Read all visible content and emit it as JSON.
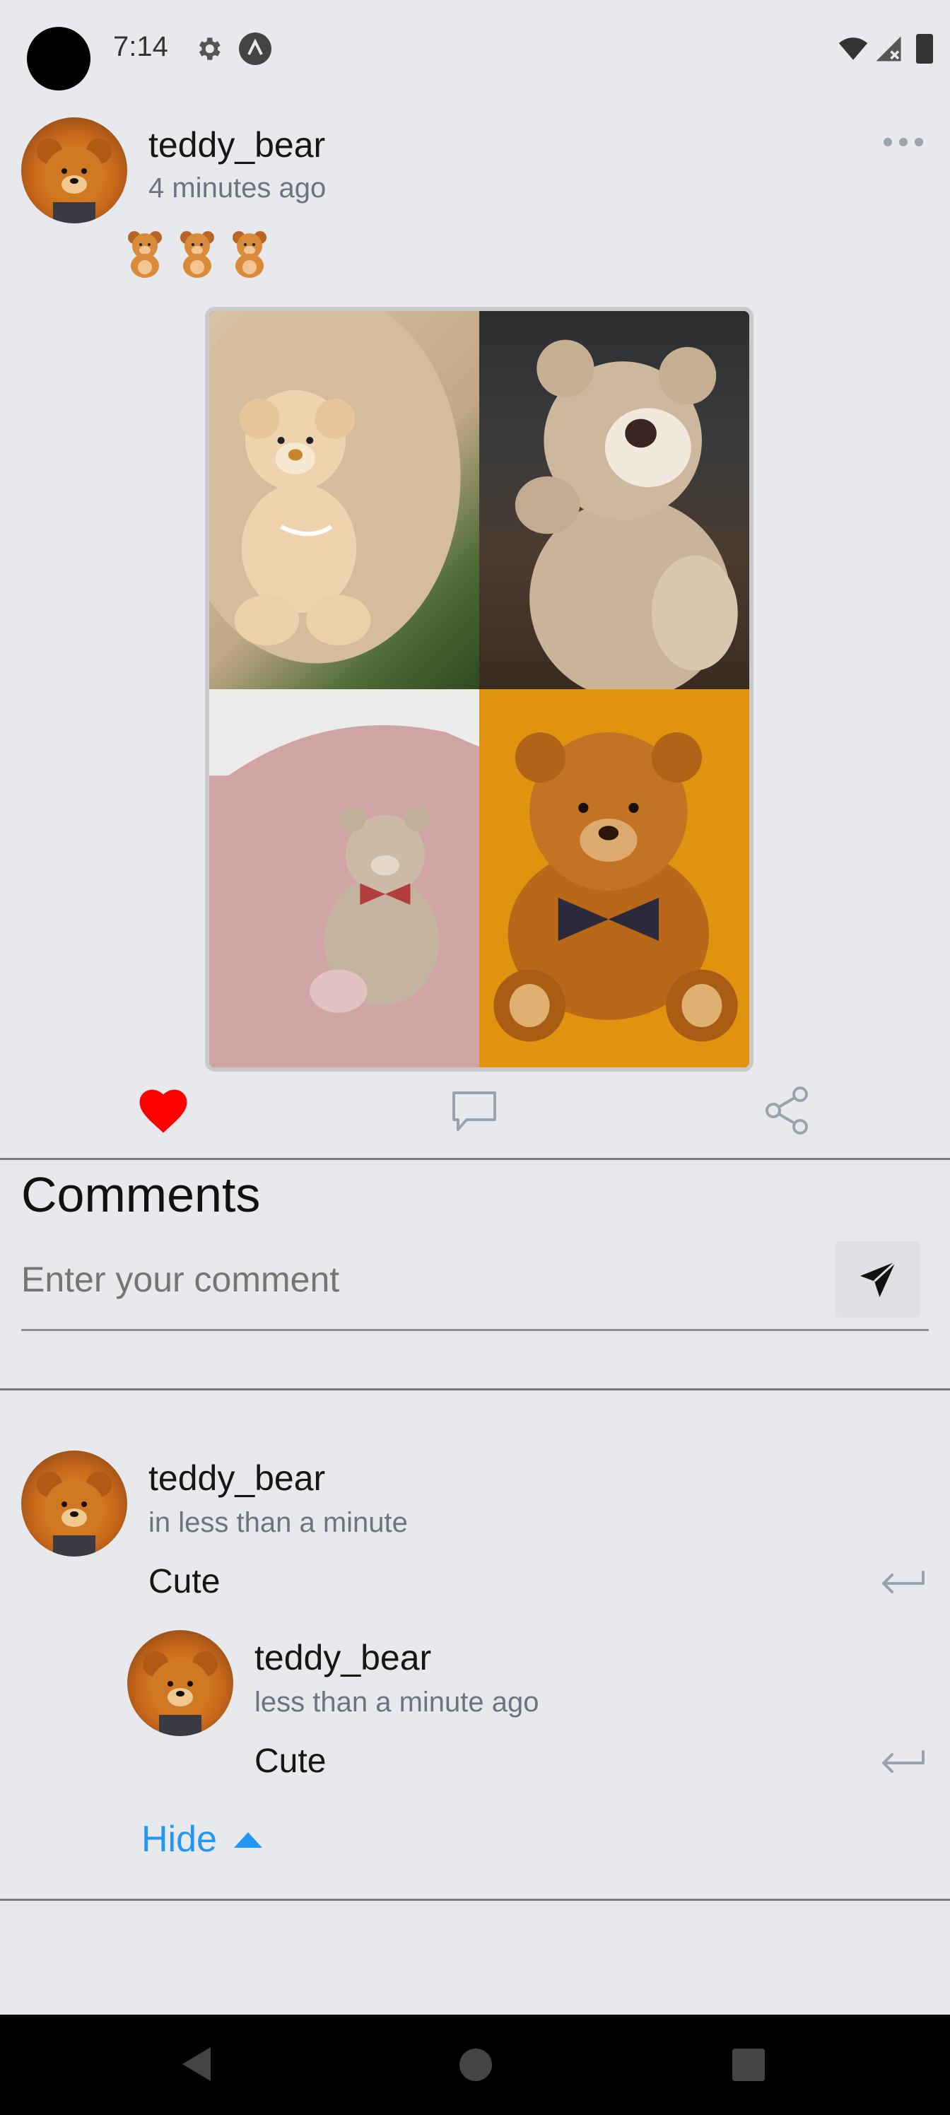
{
  "status_bar": {
    "time": "7:14",
    "icons": [
      "camera-cutout",
      "gear-icon",
      "app-a-icon",
      "wifi-icon",
      "cellular-no-signal-icon",
      "battery-icon"
    ]
  },
  "post": {
    "username": "teddy_bear",
    "timestamp": "4 minutes ago",
    "emoji_caption": [
      "🧸",
      "🧸",
      "🧸"
    ],
    "menu_icon": "more-horizontal-icon",
    "images": [
      "teddy bear on grass",
      "teddy bear on dark floor",
      "teddy bear on pink chair",
      "teddy bear on orange background"
    ],
    "actions": {
      "liked": true,
      "like_icon": "heart-icon",
      "comment_icon": "comment-icon",
      "share_icon": "share-icon"
    }
  },
  "comments_section": {
    "title": "Comments",
    "input_placeholder": "Enter your comment",
    "send_icon": "send-icon",
    "comments": [
      {
        "username": "teddy_bear",
        "timestamp": "in less than a minute",
        "text": "Cute",
        "replies": [
          {
            "username": "teddy_bear",
            "timestamp": "less than a minute ago",
            "text": "Cute"
          }
        ]
      }
    ],
    "hide_label": "Hide"
  },
  "colors": {
    "background": "#e8e9ec",
    "accent": "#2196f3",
    "like": "#ff0000",
    "muted_text": "#6b7480"
  }
}
